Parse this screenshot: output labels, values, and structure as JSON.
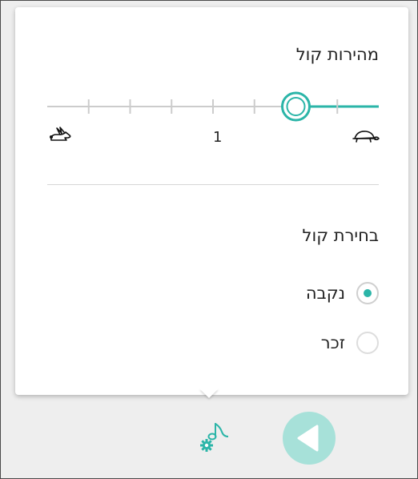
{
  "speed": {
    "title": "מהירות קול",
    "tick_label": "1",
    "slow_icon": "turtle-icon",
    "fast_icon": "rabbit-icon",
    "value_fraction": 0.75,
    "tick_count": 8
  },
  "voice": {
    "title": "בחירת קול",
    "options": [
      {
        "label": "נקבה",
        "selected": true
      },
      {
        "label": "זכר",
        "selected": false
      }
    ]
  },
  "footer": {
    "settings_icon": "voice-settings-icon",
    "play_icon": "play-icon"
  },
  "colors": {
    "accent": "#2bb5a8",
    "accent_light": "#a7e1d9",
    "track": "#cccccc"
  }
}
